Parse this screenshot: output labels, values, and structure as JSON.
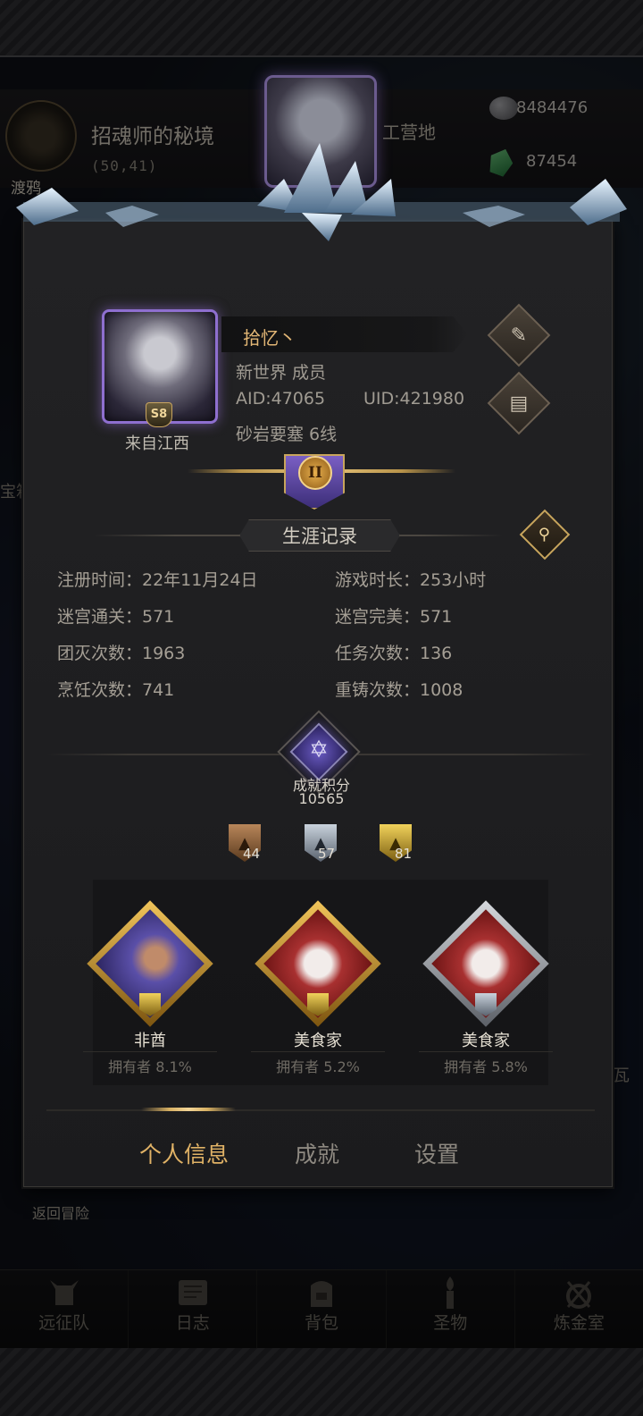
{
  "location": {
    "name": "招魂师的秘境",
    "coords": "(50,41)",
    "tag": "渡鸦",
    "camp_label": "工营地"
  },
  "currency": {
    "silver": "8484476",
    "gems": "87454"
  },
  "edge_text": {
    "left": "宝箱",
    "right": "瓦"
  },
  "return_label": "返回冒险",
  "profile": {
    "name": "拾忆丶",
    "guild_role": "新世界 成员",
    "aid": "AID:47065",
    "uid": "UID:421980",
    "server": "砂岩要塞 6线",
    "origin": "来自江西",
    "level_badge": "S8",
    "rank_numeral": "II"
  },
  "career": {
    "title": "生涯记录",
    "stats": {
      "register": "注册时间：22年11月24日",
      "playtime": "游戏时长：253小时",
      "maze_clear": "迷宫通关：571",
      "maze_perfect": "迷宫完美：571",
      "wipes": "团灭次数：1963",
      "quests": "任务次数：136",
      "cooking": "烹饪次数：741",
      "reforge": "重铸次数：1008"
    }
  },
  "achievement_points": {
    "label": "成就积分",
    "value": "10565"
  },
  "medals": {
    "bronze": "44",
    "silver": "57",
    "gold": "81"
  },
  "showcase": [
    {
      "title": "非酋",
      "owners": "拥有者 8.1%"
    },
    {
      "title": "美食家",
      "owners": "拥有者 5.2%"
    },
    {
      "title": "美食家",
      "owners": "拥有者 5.8%"
    }
  ],
  "tabs": {
    "personal": "个人信息",
    "achievements": "成就",
    "settings": "设置"
  },
  "bottom_nav": [
    {
      "label": "远征队",
      "icon": "helmet-icon"
    },
    {
      "label": "日志",
      "icon": "scroll-icon"
    },
    {
      "label": "背包",
      "icon": "backpack-icon"
    },
    {
      "label": "圣物",
      "icon": "torch-icon"
    },
    {
      "label": "炼金室",
      "icon": "alchemy-icon"
    }
  ]
}
